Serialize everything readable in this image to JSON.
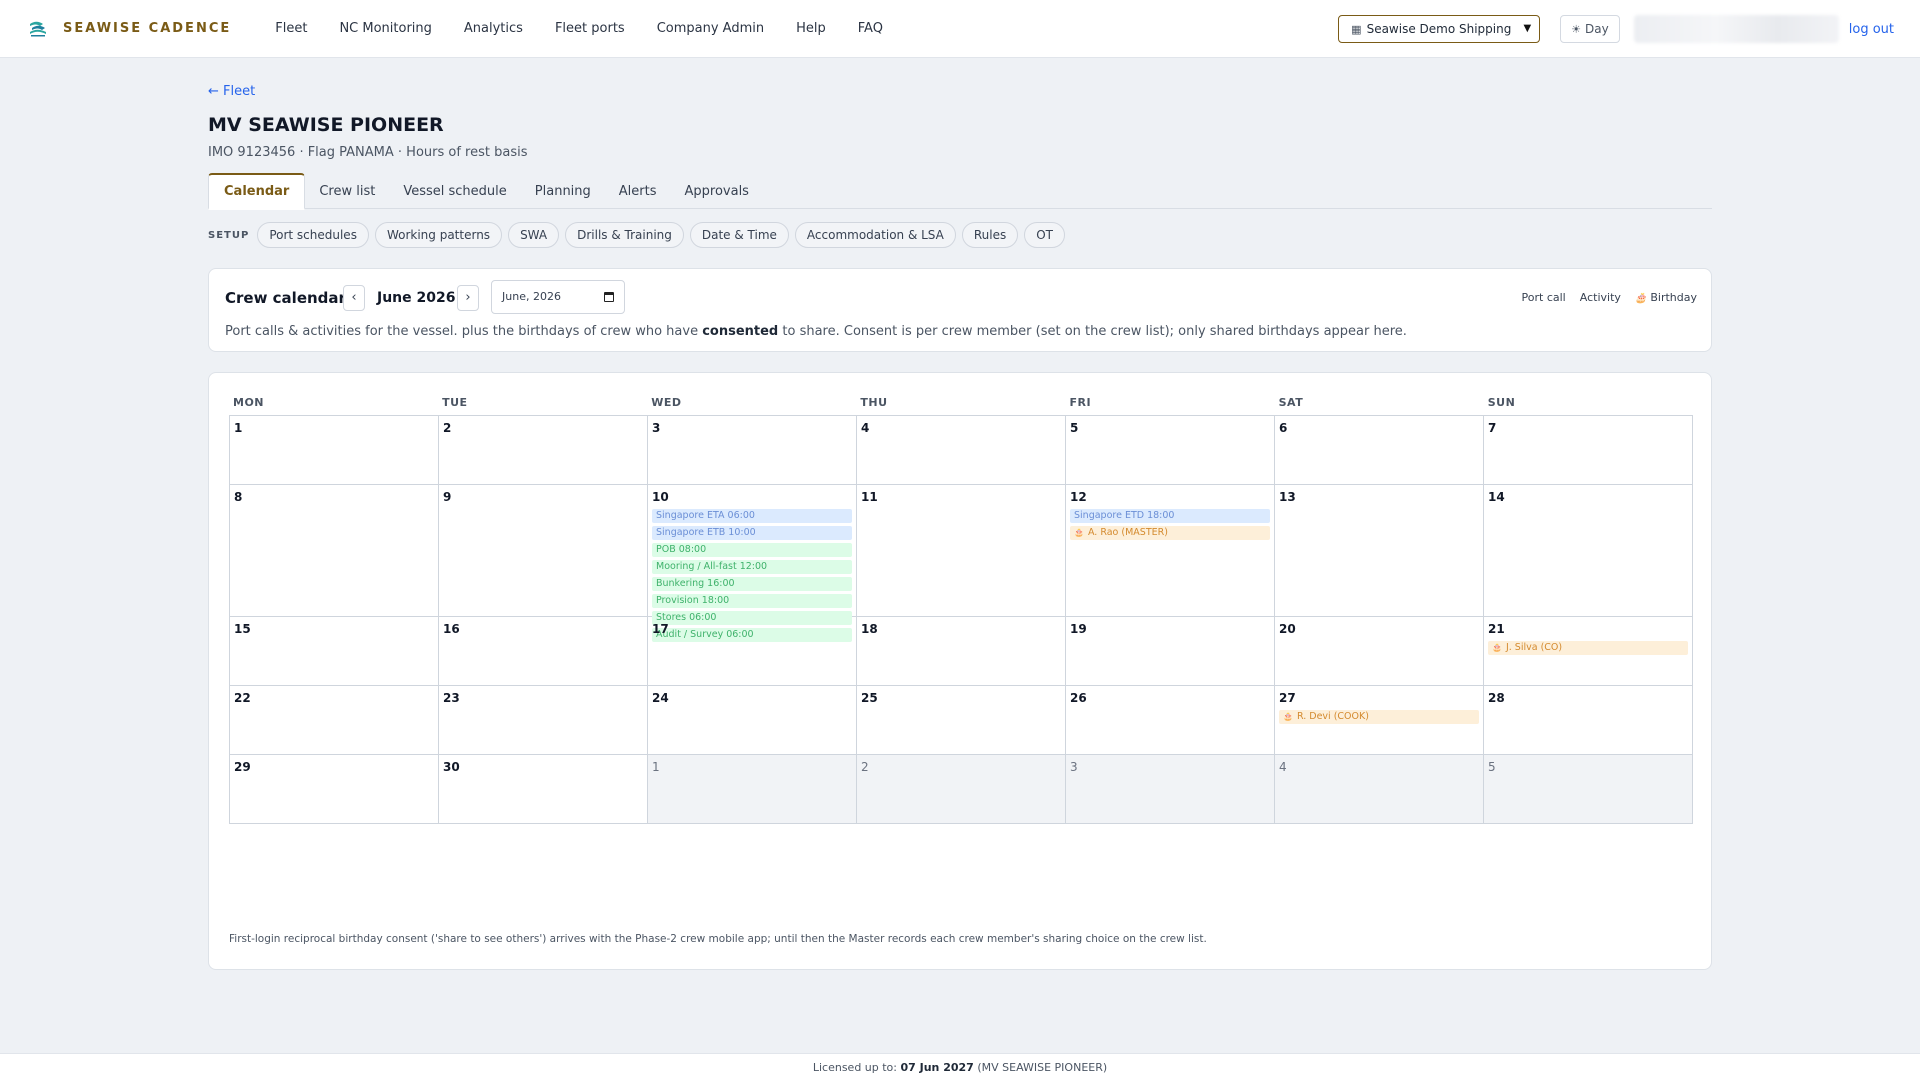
{
  "brand": {
    "name": "SEAWISE CADENCE",
    "logo_icon": "seawise-wave-logo",
    "accent": "#7a5b16"
  },
  "nav": {
    "items": [
      {
        "label": "Fleet"
      },
      {
        "label": "NC Monitoring"
      },
      {
        "label": "Analytics"
      },
      {
        "label": "Fleet ports"
      },
      {
        "label": "Company Admin"
      },
      {
        "label": "Help"
      },
      {
        "label": "FAQ"
      }
    ],
    "company_select": "Seawise Demo Shipping",
    "theme_toggle": "Day",
    "logout": "log out"
  },
  "page": {
    "back_link": "← Fleet",
    "title": "MV SEAWISE PIONEER",
    "subtitle": "IMO 9123456 · Flag PANAMA · Hours of rest basis",
    "tabs": [
      {
        "label": "Calendar",
        "active": true
      },
      {
        "label": "Crew list"
      },
      {
        "label": "Vessel schedule"
      },
      {
        "label": "Planning"
      },
      {
        "label": "Alerts"
      },
      {
        "label": "Approvals"
      }
    ],
    "setup_label": "SETUP",
    "setup_pills": [
      {
        "label": "Port schedules"
      },
      {
        "label": "Working patterns"
      },
      {
        "label": "SWA"
      },
      {
        "label": "Drills & Training"
      },
      {
        "label": "Date & Time"
      },
      {
        "label": "Accommodation & LSA"
      },
      {
        "label": "Rules"
      },
      {
        "label": "OT"
      }
    ]
  },
  "calendar": {
    "title": "Crew calendar",
    "prev": "‹",
    "next": "›",
    "month_label": "June 2026",
    "month_input": "June, 2026",
    "legend": {
      "port": "Port call",
      "activity": "Activity",
      "birthday": "Birthday"
    },
    "desc_before": "Port calls & activities for the vessel. plus the birthdays of crew who have ",
    "desc_bold": "consented",
    "desc_after": " to share. Consent is per crew member (set on the crew list); only shared birthdays appear here.",
    "weekdays": [
      "MON",
      "TUE",
      "WED",
      "THU",
      "FRI",
      "SAT",
      "SUN"
    ],
    "colors": {
      "port": "#dbeafe",
      "activity": "#dcfce7",
      "birthday": "#fdefd9"
    },
    "weeks": [
      [
        {
          "day": "1"
        },
        {
          "day": "2"
        },
        {
          "day": "3"
        },
        {
          "day": "4"
        },
        {
          "day": "5"
        },
        {
          "day": "6"
        },
        {
          "day": "7"
        }
      ],
      [
        {
          "day": "8"
        },
        {
          "day": "9"
        },
        {
          "day": "10",
          "events": [
            {
              "type": "port",
              "label": "Singapore ETA 06:00"
            },
            {
              "type": "port",
              "label": "Singapore ETB 10:00"
            },
            {
              "type": "act",
              "label": "POB 08:00"
            },
            {
              "type": "act",
              "label": "Mooring / All-fast 12:00"
            },
            {
              "type": "act",
              "label": "Bunkering 16:00"
            },
            {
              "type": "act",
              "label": "Provision 18:00"
            },
            {
              "type": "act",
              "label": "Stores 06:00"
            },
            {
              "type": "act",
              "label": "Audit / Survey 06:00"
            }
          ]
        },
        {
          "day": "11"
        },
        {
          "day": "12",
          "events": [
            {
              "type": "port",
              "label": "Singapore ETD 18:00"
            },
            {
              "type": "bday",
              "label": "A. Rao (MASTER)"
            }
          ]
        },
        {
          "day": "13"
        },
        {
          "day": "14"
        }
      ],
      [
        {
          "day": "15"
        },
        {
          "day": "16"
        },
        {
          "day": "17"
        },
        {
          "day": "18"
        },
        {
          "day": "19"
        },
        {
          "day": "20"
        },
        {
          "day": "21",
          "events": [
            {
              "type": "bday",
              "label": "J. Silva (CO)"
            }
          ]
        }
      ],
      [
        {
          "day": "22"
        },
        {
          "day": "23"
        },
        {
          "day": "24"
        },
        {
          "day": "25"
        },
        {
          "day": "26"
        },
        {
          "day": "27",
          "events": [
            {
              "type": "bday",
              "label": "R. Devi (COOK)"
            }
          ]
        },
        {
          "day": "28"
        }
      ],
      [
        {
          "day": "29"
        },
        {
          "day": "30"
        },
        {
          "day": "1",
          "other": true
        },
        {
          "day": "2",
          "other": true
        },
        {
          "day": "3",
          "other": true
        },
        {
          "day": "4",
          "other": true
        },
        {
          "day": "5",
          "other": true
        }
      ]
    ],
    "note": "First-login reciprocal birthday consent ('share to see others') arrives with the Phase-2 crew mobile app; until then the Master records each crew member's sharing choice on the crew list."
  },
  "footer": {
    "prefix": "Licensed up to: ",
    "date": "07 Jun 2027",
    "suffix": " (MV SEAWISE PIONEER)"
  }
}
